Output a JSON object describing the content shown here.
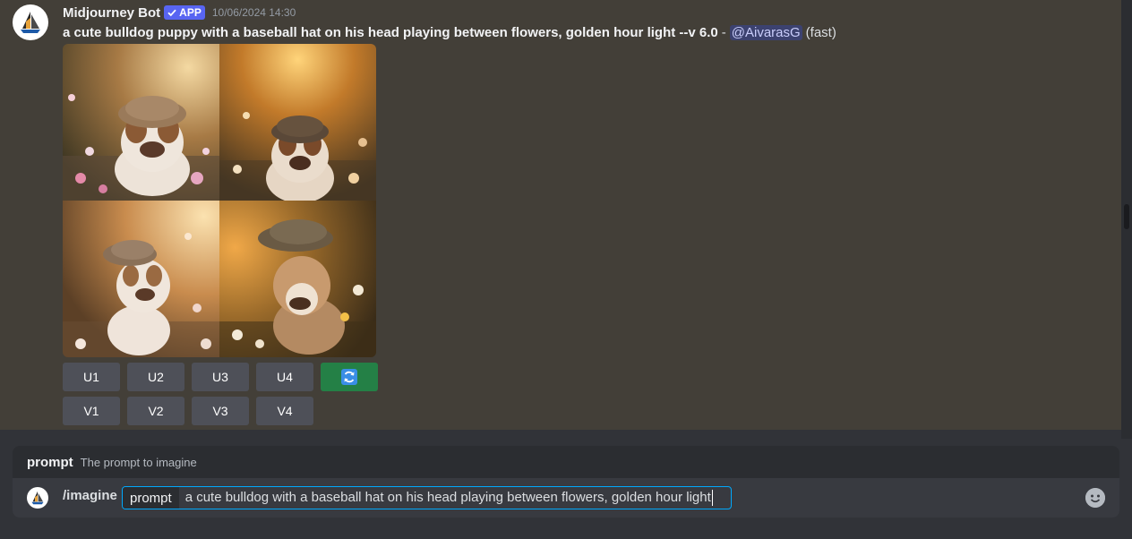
{
  "message": {
    "author": "Midjourney Bot",
    "badge": "APP",
    "timestamp": "10/06/2024 14:30",
    "prompt": "a cute bulldog puppy with a baseball hat on his head playing between flowers, golden hour light --v 6.0",
    "separator": "-",
    "mention": "@AivarasG",
    "speed": "(fast)",
    "image_alt": "grid of four bulldog puppies wearing baseball hats among flowers at golden hour",
    "buttons_row1": [
      "U1",
      "U2",
      "U3",
      "U4"
    ],
    "reroll_icon": "refresh-icon",
    "buttons_row2": [
      "V1",
      "V2",
      "V3",
      "V4"
    ]
  },
  "command_hint": {
    "name": "prompt",
    "description": "The prompt to imagine"
  },
  "composer": {
    "command": "/imagine",
    "option_label": "prompt",
    "option_value": "a cute bulldog with a baseball hat on his head playing between flowers, golden hour light",
    "emoji_icon": "emoji-smile-icon"
  },
  "colors": {
    "accent": "#5865f2",
    "success": "#248046",
    "focus": "#00a8fc"
  }
}
